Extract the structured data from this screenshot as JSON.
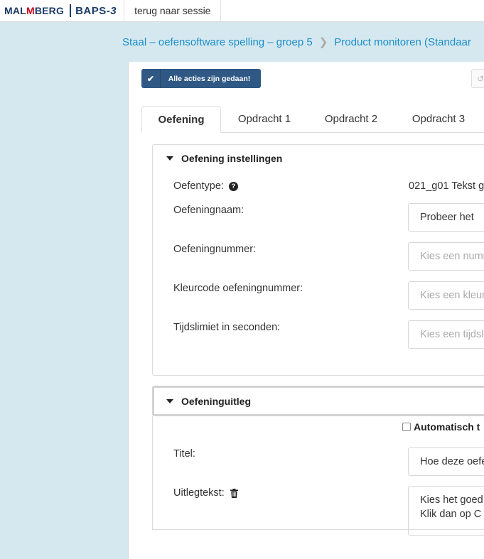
{
  "topbar": {
    "brand_malmberg_pre": "MAL",
    "brand_malmberg_m": "M",
    "brand_malmberg_post": "BERG",
    "brand_baps": "BAPS-",
    "brand_baps_num": "3",
    "back_link": "terug naar sessie"
  },
  "breadcrumb": {
    "items": [
      "Staal – oefensoftware spelling – groep 5",
      "Product monitoren (Standaar"
    ]
  },
  "toolbar": {
    "status_label": "Alle acties zijn gedaan!"
  },
  "tabs": [
    {
      "label": "Oefening",
      "active": true
    },
    {
      "label": "Opdracht 1",
      "active": false
    },
    {
      "label": "Opdracht 2",
      "active": false
    },
    {
      "label": "Opdracht 3",
      "active": false
    }
  ],
  "settings": {
    "title": "Oefening instellingen",
    "fields": {
      "type_label": "Oefentype:",
      "type_value": "021_g01 Tekst g",
      "name_label": "Oefeningnaam:",
      "name_value": "Probeer het",
      "number_label": "Oefeningnummer:",
      "number_placeholder": "Kies een numm",
      "color_label": "Kleurcode oefeningnummer:",
      "color_placeholder": "Kies een kleur",
      "time_label": "Tijdslimiet in seconden:",
      "time_placeholder": "Kies een tijdsl"
    }
  },
  "explanation": {
    "title": "Oefeninguitleg",
    "auto_checkbox_label": "Automatisch t",
    "title_label": "Titel:",
    "title_value": "Hoe deze oefe",
    "text_label": "Uitlegtekst:",
    "text_value_line1": "Kies het goed",
    "text_value_line2": "Klik dan op C"
  },
  "colors": {
    "primary_button": "#2f5884",
    "link": "#1a8fc9",
    "background": "#d6e8ef",
    "brand_red": "#d0021b"
  }
}
